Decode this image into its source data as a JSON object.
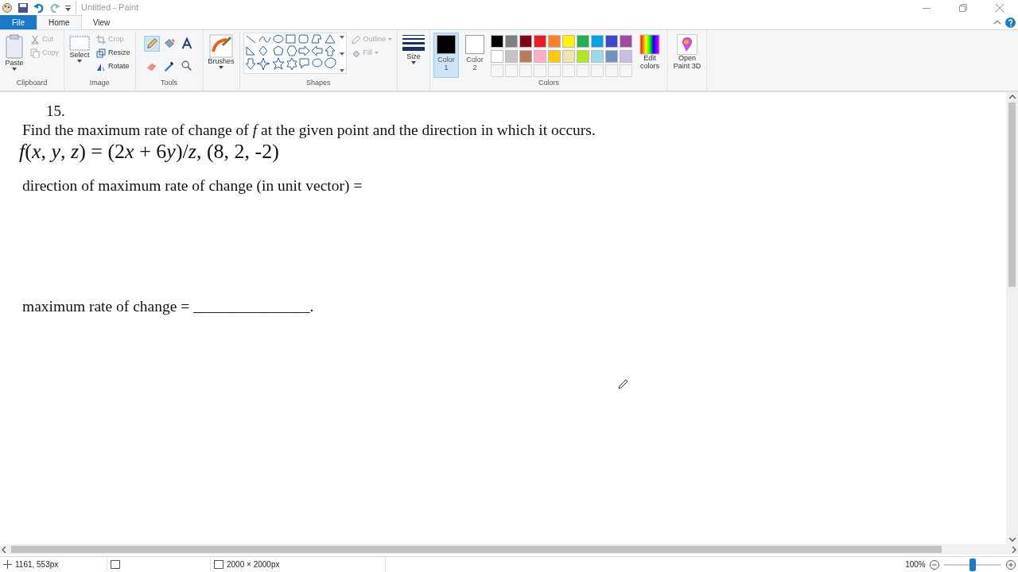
{
  "window": {
    "title": "Untitled - Paint"
  },
  "tabs": [
    {
      "label": "File",
      "selected": false,
      "kind": "file"
    },
    {
      "label": "Home",
      "selected": true,
      "kind": "tab"
    },
    {
      "label": "View",
      "selected": false,
      "kind": "tab"
    }
  ],
  "ribbon": {
    "clipboard": {
      "label": "Clipboard",
      "paste": "Paste",
      "items": [
        {
          "label": "Cut",
          "kind": "cut",
          "disabled": true
        },
        {
          "label": "Copy",
          "kind": "copy",
          "disabled": true
        }
      ]
    },
    "image": {
      "label": "Image",
      "select": "Select",
      "items": [
        {
          "label": "Crop",
          "kind": "crop",
          "disabled": true
        },
        {
          "label": "Resize",
          "kind": "resize",
          "disabled": false
        },
        {
          "label": "Rotate",
          "kind": "rotate",
          "disabled": false
        }
      ]
    },
    "tools": {
      "label": "Tools",
      "items": [
        {
          "kind": "pencil",
          "selected": true
        },
        {
          "kind": "fill",
          "selected": false
        },
        {
          "kind": "text",
          "selected": false
        },
        {
          "kind": "eraser",
          "selected": false
        },
        {
          "kind": "picker",
          "selected": false
        },
        {
          "kind": "magnifier",
          "selected": false
        }
      ]
    },
    "brushes": {
      "label": "Brushes"
    },
    "shapes": {
      "label": "Shapes",
      "options": [
        {
          "label": "Outline",
          "disabled": true
        },
        {
          "label": "Fill",
          "disabled": true
        }
      ]
    },
    "size": {
      "label": "Size"
    },
    "colors": {
      "label": "Colors",
      "slots": [
        {
          "label": "Color 1",
          "color": "#000000",
          "selected": true
        },
        {
          "label": "Color 2",
          "color": "#ffffff",
          "selected": false
        }
      ],
      "palette": [
        {
          "color": "#000000"
        },
        {
          "color": "#7f7f7f"
        },
        {
          "color": "#880015"
        },
        {
          "color": "#ed1c24"
        },
        {
          "color": "#ff7f27"
        },
        {
          "color": "#fff200"
        },
        {
          "color": "#22b14c"
        },
        {
          "color": "#00a2e8"
        },
        {
          "color": "#3f48cc"
        },
        {
          "color": "#a349a4"
        },
        {
          "color": "#ffffff"
        },
        {
          "color": "#c3c3c3"
        },
        {
          "color": "#b97a57"
        },
        {
          "color": "#ffaec9"
        },
        {
          "color": "#ffc90e"
        },
        {
          "color": "#efe4b0"
        },
        {
          "color": "#b5e61d"
        },
        {
          "color": "#99d9ea"
        },
        {
          "color": "#7092be"
        },
        {
          "color": "#c8bfe7"
        }
      ],
      "edit": "Edit colors"
    },
    "paint3d": "Open Paint 3D"
  },
  "document": {
    "lines": [
      {
        "kind": "number",
        "text": "15."
      },
      {
        "kind": "prompt",
        "text": "Find the maximum rate of change of *f* at the given point and the direction in which it occurs."
      },
      {
        "kind": "formula",
        "segments": [
          {
            "text": "f",
            "italic": true
          },
          {
            "text": "(",
            "italic": false
          },
          {
            "text": "x",
            "italic": true
          },
          {
            "text": ", ",
            "italic": false
          },
          {
            "text": "y",
            "italic": true
          },
          {
            "text": ", ",
            "italic": false
          },
          {
            "text": "z",
            "italic": true
          },
          {
            "text": ") = (2",
            "italic": false
          },
          {
            "text": "x",
            "italic": true
          },
          {
            "text": " + 6",
            "italic": false
          },
          {
            "text": "y",
            "italic": true
          },
          {
            "text": ")/",
            "italic": false
          },
          {
            "text": "z",
            "italic": true
          },
          {
            "text": ", (8, 2, -2)",
            "italic": false
          }
        ]
      },
      {
        "kind": "prompt",
        "text": "direction of maximum rate of change (in unit vector) ="
      },
      {
        "kind": "answer",
        "text": "maximum rate of change = _______________."
      }
    ]
  },
  "status_bar": {
    "position": "1161, 553px",
    "size": "2000 × 2000px",
    "zoom": "100%",
    "zoom_slider": {
      "level": 0.5
    }
  }
}
